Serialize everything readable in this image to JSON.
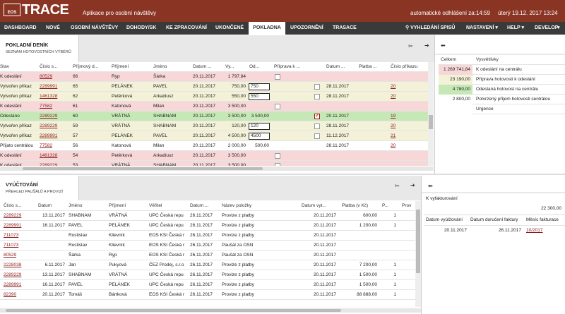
{
  "app": {
    "logo_badge": "EOS",
    "logo_text": "TRACE",
    "subtitle": "Aplikace pro osobní návštěvy",
    "logout": "automatické odhlášení za:14:59",
    "datetime": "úterý 19.12. 2017 13:24"
  },
  "nav": {
    "items": [
      "DASHBOARD",
      "NOVÉ",
      "OSOBNÍ NÁVŠTĚVY",
      "DOHODY/SK",
      "KE ZPRACOVÁNÍ",
      "UKONČENÉ",
      "POKLADNA",
      "UPOZORNĚNÍ",
      "TRASACE"
    ],
    "search": "VYHLEDÁNÍ SPISŮ",
    "settings": "NASTAVENÍ",
    "help": "HELP",
    "dev": "DEVELOP"
  },
  "pokladni": {
    "title": "POKLADNÍ DENÍK",
    "subtitle": "SEZNAM HOTOVOSTNÍCH VÝBĚRŮ",
    "headers": [
      "Stav",
      "Číslo s...",
      "Příjmový d...",
      "Příjmení",
      "Jméno",
      "Datum ...",
      "Vy...",
      "Od...",
      "Příprava k ...",
      "",
      "Datum ...",
      "Platba ...",
      "Číslo příkazu"
    ],
    "rows": [
      {
        "bg": "#f7d7d8",
        "stav": "K odeslání",
        "cislo": "80529",
        "prijmovy": "66",
        "prijmeni": "Ryp",
        "jmeno": "Šárka",
        "datum": "20.11.2017",
        "vy": "1 797,84",
        "od": "",
        "prip_cb": "empty",
        "cb2": "",
        "datum2": "",
        "platba": "",
        "prikaz": ""
      },
      {
        "bg": "#f3f2d8",
        "stav": "Vytvořen příkaz",
        "cislo": "2289991",
        "prijmovy": "65",
        "prijmeni": "PELÁNEK",
        "jmeno": "PAVEL",
        "datum": "20.11.2017",
        "vy": "750,00",
        "od": "750",
        "prip_cb": "",
        "cb2": "empty",
        "datum2": "28.11.2017",
        "platba": "",
        "prikaz": "20"
      },
      {
        "bg": "#f3f2d8",
        "stav": "Vytvořen příkaz",
        "cislo": "1461328",
        "prijmovy": "62",
        "prijmeni": "Petěrková",
        "jmeno": "Arkadiusz",
        "datum": "20.11.2017",
        "vy": "550,00",
        "od": "550",
        "prip_cb": "",
        "cb2": "empty",
        "datum2": "28.11.2017",
        "platba": "",
        "prikaz": "20"
      },
      {
        "bg": "#f7d7d8",
        "stav": "K odeslání",
        "cislo": "77582",
        "prijmovy": "61",
        "prijmeni": "Katonová",
        "jmeno": "Milan",
        "datum": "20.11.2017",
        "vy": "3 500,00",
        "od": "",
        "prip_cb": "empty",
        "cb2": "",
        "datum2": "",
        "platba": "",
        "prikaz": ""
      },
      {
        "bg": "#c6e8b6",
        "stav": "Odesláno",
        "cislo": "2289229",
        "prijmovy": "60",
        "prijmeni": "VRÁTNÁ",
        "jmeno": "SHABNAM",
        "datum": "20.11.2017",
        "vy": "3 500,00",
        "od": "3 500,00",
        "prip_cb": "",
        "cb2": "checked",
        "datum2": "20.11.2017",
        "platba": "",
        "prikaz": "19"
      },
      {
        "bg": "#f3f2d8",
        "stav": "Vytvořen příkaz",
        "cislo": "2289229",
        "prijmovy": "59",
        "prijmeni": "VRÁTNÁ",
        "jmeno": "SHABNAM",
        "datum": "20.11.2017",
        "vy": "120,00",
        "od": "120",
        "prip_cb": "",
        "cb2": "empty",
        "datum2": "28.11.2017",
        "platba": "",
        "prikaz": "20"
      },
      {
        "bg": "#f3f2d8",
        "stav": "Vytvořen příkaz",
        "cislo": "2289991",
        "prijmovy": "57",
        "prijmeni": "PELÁNEK",
        "jmeno": "PAVEL",
        "datum": "20.11.2017",
        "vy": "4 500,00",
        "od": "4500",
        "prip_cb": "",
        "cb2": "empty",
        "datum2": "11.12.2017",
        "platba": "",
        "prikaz": "21"
      },
      {
        "bg": "#ffffff",
        "stav": "Přijato centrálou",
        "cislo": "77582",
        "prijmovy": "56",
        "prijmeni": "Katonová",
        "jmeno": "Milan",
        "datum": "20.11.2017",
        "vy": "2 000,00",
        "od": "500,00",
        "prip_cb": "",
        "cb2": "",
        "datum2": "28.11.2017",
        "platba": "",
        "prikaz": "20"
      },
      {
        "bg": "#f7d7d8",
        "stav": "K odeslání",
        "cislo": "1461328",
        "prijmovy": "54",
        "prijmeni": "Petěrková",
        "jmeno": "Arkadiusz",
        "datum": "20.11.2017",
        "vy": "3 500,00",
        "od": "",
        "prip_cb": "empty",
        "cb2": "",
        "datum2": "",
        "platba": "",
        "prikaz": ""
      },
      {
        "bg": "#f7d7d8",
        "stav": "K odeslání",
        "cislo": "2289229",
        "prijmovy": "53",
        "prijmeni": "VRÁTNÁ",
        "jmeno": "SHABNAM",
        "datum": "20.11.2017",
        "vy": "3 500,00",
        "od": "",
        "prip_cb": "empty",
        "cb2": "",
        "datum2": "",
        "platba": "",
        "prikaz": ""
      }
    ]
  },
  "legend": {
    "headers": [
      "Celkem",
      "Vysvětlivky"
    ],
    "rows": [
      {
        "bg": "#f7d7d8",
        "celkem": "1 269 741,84",
        "text": "K odeslání na centrálu"
      },
      {
        "bg": "#f3f2d8",
        "celkem": "23 190,00",
        "text": "Příprava hotovosti k odeslání"
      },
      {
        "bg": "#c6e8b6",
        "celkem": "4 780,00",
        "text": "Odeslaná hotovost na centrálu"
      },
      {
        "bg": "#ffffff",
        "celkem": "2 800,00",
        "text": "Potvrzený příjem hotovosti centrálou"
      },
      {
        "bg": "#ffffff",
        "celkem": "",
        "text": "Urgence"
      }
    ]
  },
  "vyuctovani": {
    "title": "VYÚČTOVÁNÍ",
    "subtitle": "PŘEHLED PAUŠÁLŮ A PROVIZÍ",
    "headers": [
      "Číslo s...",
      "Datum",
      "Jméno",
      "Příjmení",
      "Věřitel",
      "Datum ...",
      "Název položky",
      "Datum vyt...",
      "Platba (v Kč)",
      "P...",
      "Prov"
    ],
    "rows": [
      {
        "cislo": "2289229",
        "datum": "13.11.2017",
        "jmeno": "SHABNAM",
        "prijmeni": "VRÁTNÁ",
        "veritel": "UPC Česká repu",
        "datum2": "26.11.2017",
        "nazev": "Provize z platby",
        "datum3": "20.11.2017",
        "platba": "600,00",
        "p": "1",
        "prov": ""
      },
      {
        "cislo": "2289991",
        "datum": "16.11.2017",
        "jmeno": "PAVEL",
        "prijmeni": "PELÁNEK",
        "veritel": "UPC Česká repu",
        "datum2": "26.11.2017",
        "nazev": "Provize z platby",
        "datum3": "20.11.2017",
        "platba": "1 200,00",
        "p": "1",
        "prov": ""
      },
      {
        "cislo": "711073",
        "datum": "",
        "jmeno": "Rostislav",
        "prijmeni": "Klievník",
        "veritel": "EOS KSI Česká r",
        "datum2": "26.11.2017",
        "nazev": "Provize z platby",
        "datum3": "20.11.2017",
        "platba": "",
        "p": "",
        "prov": ""
      },
      {
        "cislo": "711073",
        "datum": "",
        "jmeno": "Rostislav",
        "prijmeni": "Klievník",
        "veritel": "EOS KSI Česká r",
        "datum2": "26.11.2017",
        "nazev": "Paušál za OSN",
        "datum3": "20.11.2017",
        "platba": "",
        "p": "",
        "prov": ""
      },
      {
        "cislo": "80529",
        "datum": "",
        "jmeno": "Šárka",
        "prijmeni": "Ryp",
        "veritel": "EOS KSI Česká r",
        "datum2": "26.11.2017",
        "nazev": "Paušál za OSN",
        "datum3": "20.11.2017",
        "platba": "",
        "p": "",
        "prov": ""
      },
      {
        "cislo": "2228038",
        "datum": "6.11.2017",
        "jmeno": "Jan",
        "prijmeni": "Pukyová",
        "veritel": "ČEZ Prodej, s.r.o",
        "datum2": "26.11.2017",
        "nazev": "Provize z platby",
        "datum3": "20.11.2017",
        "platba": "7 200,00",
        "p": "1",
        "prov": ""
      },
      {
        "cislo": "2289229",
        "datum": "13.11.2017",
        "jmeno": "SHABNAM",
        "prijmeni": "VRÁTNÁ",
        "veritel": "UPC Česká repu",
        "datum2": "26.11.2017",
        "nazev": "Provize z platby",
        "datum3": "20.11.2017",
        "platba": "1 500,00",
        "p": "1",
        "prov": ""
      },
      {
        "cislo": "2289991",
        "datum": "16.11.2017",
        "jmeno": "PAVEL",
        "prijmeni": "PELÁNEK",
        "veritel": "UPC Česká repu",
        "datum2": "26.11.2017",
        "nazev": "Provize z platby",
        "datum3": "20.11.2017",
        "platba": "1 500,00",
        "p": "1",
        "prov": ""
      },
      {
        "cislo": "82390",
        "datum": "20.11.2017",
        "jmeno": "Tomáš",
        "prijmeni": "Bártková",
        "veritel": "EOS KSI Česká r",
        "datum2": "26.11.2017",
        "nazev": "Provize z platby",
        "datum3": "20.11.2017",
        "platba": "88 888,00",
        "p": "1",
        "prov": ""
      }
    ]
  },
  "kvyfakturovani": {
    "label": "K vyfakturování",
    "amount": "22 300,00",
    "headers": [
      "Datum vyúčtování",
      "Datum doručení faktury",
      "Měsíc fakturace"
    ],
    "row": {
      "datum": "20.11.2017",
      "doruceni": "26.11.2017",
      "mesic": "10/2017"
    }
  }
}
